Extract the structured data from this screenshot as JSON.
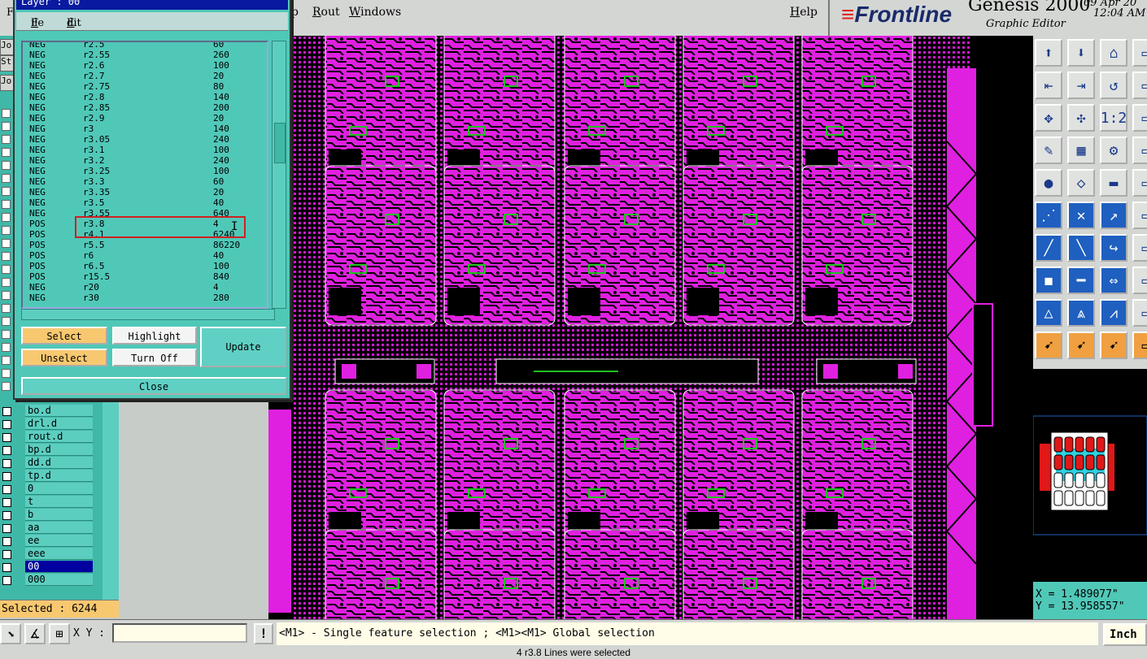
{
  "menubar": {
    "items": [
      {
        "prefix": "",
        "ul": "",
        "rest": "p"
      },
      {
        "prefix": "",
        "ul": "R",
        "rest": "out"
      },
      {
        "prefix": "",
        "ul": "W",
        "rest": "indows"
      },
      {
        "prefix": "",
        "ul": "H",
        "rest": "elp"
      }
    ]
  },
  "brand": {
    "logo": "Frontline",
    "product": "Genesis 2000",
    "subtitle": "Graphic Editor",
    "date": "09 Apr 20",
    "time": "12:04 AM"
  },
  "dialog": {
    "title": "Layer :  00",
    "menu": {
      "file": "File",
      "edit": "Edit"
    },
    "rows": [
      {
        "pol": "NEG",
        "sym": "r2.5",
        "count": "60"
      },
      {
        "pol": "NEG",
        "sym": "r2.55",
        "count": "260"
      },
      {
        "pol": "NEG",
        "sym": "r2.6",
        "count": "100"
      },
      {
        "pol": "NEG",
        "sym": "r2.7",
        "count": "20"
      },
      {
        "pol": "NEG",
        "sym": "r2.75",
        "count": "80"
      },
      {
        "pol": "NEG",
        "sym": "r2.8",
        "count": "140"
      },
      {
        "pol": "NEG",
        "sym": "r2.85",
        "count": "200"
      },
      {
        "pol": "NEG",
        "sym": "r2.9",
        "count": "20"
      },
      {
        "pol": "NEG",
        "sym": "r3",
        "count": "140"
      },
      {
        "pol": "NEG",
        "sym": "r3.05",
        "count": "240"
      },
      {
        "pol": "NEG",
        "sym": "r3.1",
        "count": "100"
      },
      {
        "pol": "NEG",
        "sym": "r3.2",
        "count": "240"
      },
      {
        "pol": "NEG",
        "sym": "r3.25",
        "count": "100"
      },
      {
        "pol": "NEG",
        "sym": "r3.3",
        "count": "60"
      },
      {
        "pol": "NEG",
        "sym": "r3.35",
        "count": "20"
      },
      {
        "pol": "NEG",
        "sym": "r3.5",
        "count": "40"
      },
      {
        "pol": "NEG",
        "sym": "r3.55",
        "count": "640"
      },
      {
        "pol": "POS",
        "sym": "r3.8",
        "count": "4"
      },
      {
        "pol": "POS",
        "sym": "r4.1",
        "count": "6240"
      },
      {
        "pol": "POS",
        "sym": "r5.5",
        "count": "86220"
      },
      {
        "pol": "POS",
        "sym": "r6",
        "count": "40"
      },
      {
        "pol": "POS",
        "sym": "r6.5",
        "count": "100"
      },
      {
        "pol": "POS",
        "sym": "r15.5",
        "count": "840"
      },
      {
        "pol": "NEG",
        "sym": "r20",
        "count": "4"
      },
      {
        "pol": "NEG",
        "sym": "r30",
        "count": "280"
      }
    ],
    "buttons": {
      "select": "Select",
      "unselect": "Unselect",
      "highlight": "Highlight",
      "turn_off": "Turn Off",
      "update": "Update",
      "close": "Close"
    }
  },
  "left_panel": {
    "tabs": [
      "Jo",
      "St",
      "Jo"
    ],
    "layers": [
      "bo.d",
      "drl.d",
      "rout.d",
      "bp.d",
      "dd.d",
      "tp.d",
      "0",
      "t",
      "b",
      "aa",
      "ee",
      "eee",
      "00",
      "000"
    ],
    "active_layer": "00",
    "selected_text": "Selected : 6244"
  },
  "coords": {
    "x": "X = 1.489077\"",
    "y": "Y = 13.958557\""
  },
  "bottom": {
    "xy_label": "X Y :",
    "bang": "!",
    "message": "<M1> - Single feature selection ; <M1><M1> Global selection",
    "units": "Inch",
    "footer": "4 r3.8 Lines were selected"
  },
  "colors": {
    "copper": "#e020e0",
    "green_trace": "#20c020",
    "board_bg": "#000000",
    "dialog_bg": "#50c8b8",
    "highlight_box": "#d02020"
  }
}
